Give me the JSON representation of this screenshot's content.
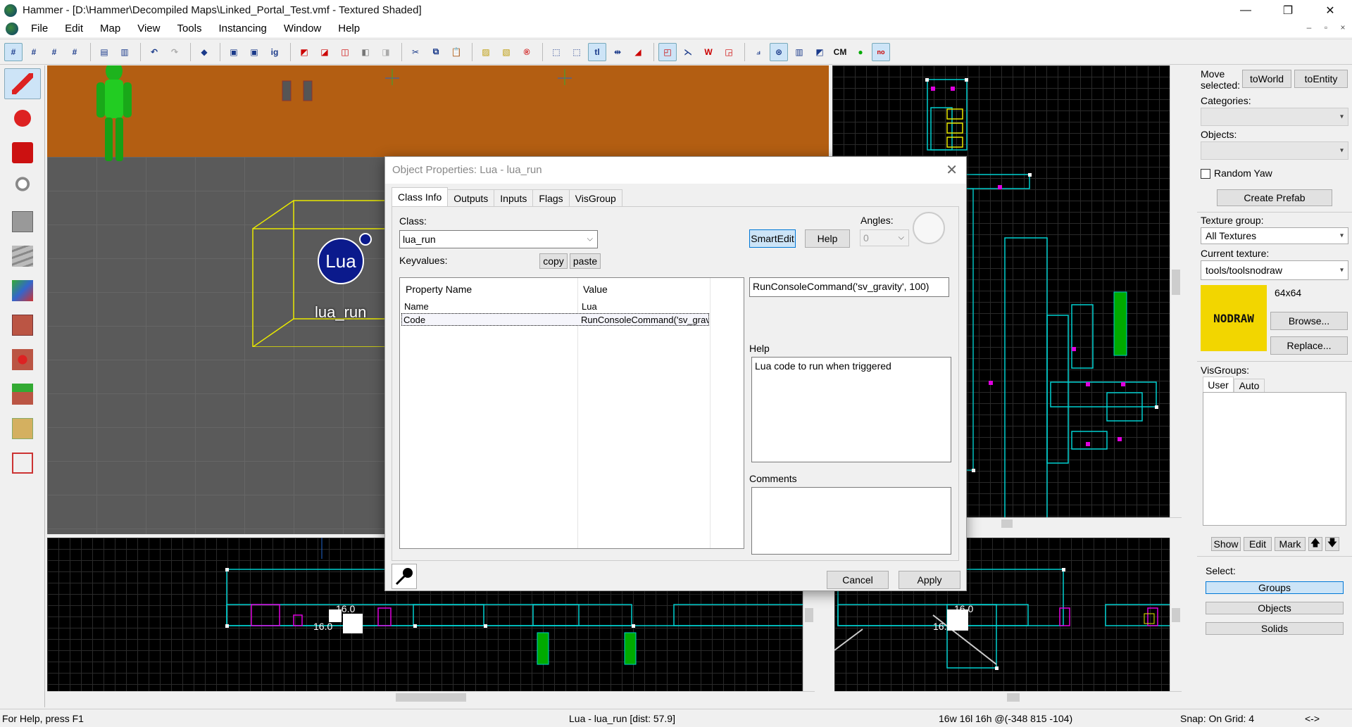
{
  "window": {
    "title": "Hammer - [D:\\Hammer\\Decompiled Maps\\Linked_Portal_Test.vmf - Textured Shaded]",
    "minimize": "—",
    "maximize": "❐",
    "close": "✕"
  },
  "menu": {
    "items": [
      "File",
      "Edit",
      "Map",
      "View",
      "Tools",
      "Instancing",
      "Window",
      "Help"
    ],
    "mdi_min": "–",
    "mdi_restore": "▫",
    "mdi_close": "×"
  },
  "toolbar": {
    "cm_label": "CM",
    "tl_label": "tl",
    "ig_label": "ig"
  },
  "view3d": {
    "entity_label": "lua_run",
    "logo_text": "Lua"
  },
  "gridviews": {
    "bottom_left": {
      "labels": [
        "16.0",
        "16.0"
      ]
    },
    "bottom_right": {
      "labels": [
        "16.0",
        "16.0"
      ]
    }
  },
  "right_panel": {
    "move_selected_label": "Move selected:",
    "to_world": "toWorld",
    "to_entity": "toEntity",
    "categories_label": "Categories:",
    "objects_label": "Objects:",
    "random_yaw": "Random Yaw",
    "create_prefab": "Create Prefab",
    "texture_group_label": "Texture group:",
    "texture_group_value": "All Textures",
    "current_texture_label": "Current texture:",
    "current_texture_value": "tools/toolsnodraw",
    "texture_size": "64x64",
    "texture_preview_text": "NODRAW",
    "browse": "Browse...",
    "replace": "Replace...",
    "visgroups_label": "VisGroups:",
    "tab_user": "User",
    "tab_auto": "Auto",
    "show": "Show",
    "edit": "Edit",
    "mark": "Mark",
    "up_arrow": "🡅",
    "down_arrow": "🡇",
    "select_label": "Select:",
    "groups": "Groups",
    "objects": "Objects",
    "solids": "Solids"
  },
  "dialog": {
    "title": "Object Properties: Lua - lua_run",
    "close": "✕",
    "tabs": [
      "Class Info",
      "Outputs",
      "Inputs",
      "Flags",
      "VisGroup"
    ],
    "class_label": "Class:",
    "class_value": "lua_run",
    "keyvalues_label": "Keyvalues:",
    "copy": "copy",
    "paste": "paste",
    "smartedit": "SmartEdit",
    "help_button": "Help",
    "angles_label": "Angles:",
    "angles_value": "0",
    "col_property": "Property Name",
    "col_value": "Value",
    "rows": [
      {
        "name": "Name",
        "value": "Lua"
      },
      {
        "name": "Code",
        "value": "RunConsoleCommand('sv_grav"
      }
    ],
    "value_edit": "RunConsoleCommand('sv_gravity', 100)",
    "help_label": "Help",
    "help_text": "Lua code to run when triggered",
    "comments_label": "Comments",
    "comments_text": "",
    "cancel": "Cancel",
    "apply": "Apply"
  },
  "statusbar": {
    "help": "For Help, press F1",
    "selection": "Lua - lua_run   [dist: 57.9]",
    "size": "16w 16l 16h @(-348 815 -104)",
    "snap": "Snap: On Grid: 4",
    "arrows": "<->"
  },
  "colors": {
    "wall": "#b35e12",
    "floor": "#5a5a5a",
    "grid_bg": "#000000",
    "brush_cyan": "#00d0d0",
    "entity_magenta": "#e000e0",
    "selection_yellow": "#e8e800",
    "nodraw_yellow": "#f2d600",
    "lua_blue": "#0b1a8c"
  }
}
